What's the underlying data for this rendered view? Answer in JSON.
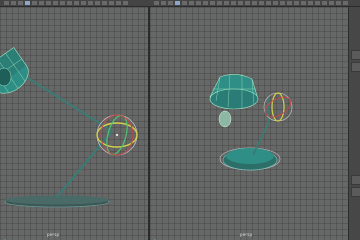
{
  "app": {
    "viewports": [
      {
        "id": "left",
        "label": "persp"
      },
      {
        "id": "right",
        "label": "persp"
      }
    ]
  },
  "colors": {
    "viewport_bg": "#666767",
    "lamp_teal": "#2f8e86",
    "lamp_dark": "#2a4f4c",
    "highlight_wire": "#9fe6c4",
    "gizmo_yellow": "#d2d24a",
    "gizmo_green": "#4fc36e",
    "gizmo_red": "#c84a4a"
  },
  "icons": [
    "view-cube-icon",
    "axis-icon",
    "panel-tab-icon"
  ]
}
